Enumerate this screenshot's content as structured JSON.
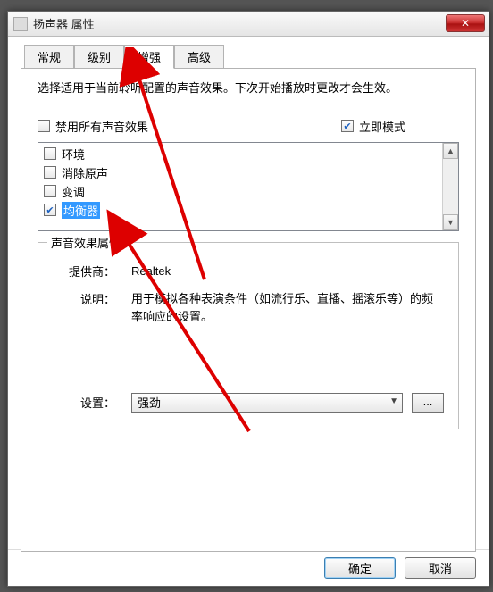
{
  "window": {
    "title": "扬声器 属性",
    "close_glyph": "✕"
  },
  "tabs": {
    "t0": "常规",
    "t1": "级别",
    "t2": "增强",
    "t3": "高级",
    "active_index": 2
  },
  "enhance": {
    "description": "选择适用于当前聆听配置的声音效果。下次开始播放时更改才会生效。",
    "disable_all_label": "禁用所有声音效果",
    "disable_all_checked": false,
    "immediate_label": "立即模式",
    "immediate_checked": true,
    "effects": [
      {
        "label": "环境",
        "checked": false,
        "selected": false
      },
      {
        "label": "消除原声",
        "checked": false,
        "selected": false
      },
      {
        "label": "变调",
        "checked": false,
        "selected": false
      },
      {
        "label": "均衡器",
        "checked": true,
        "selected": true
      }
    ],
    "scroll_up": "▲",
    "scroll_down": "▼"
  },
  "group": {
    "title": "声音效果属性",
    "provider_label": "提供商：",
    "provider_value": "Realtek",
    "desc_label": "说明：",
    "desc_value": "用于模拟各种表演条件（如流行乐、直播、摇滚乐等）的频率响应的设置。",
    "setting_label": "设置：",
    "setting_value": "强劲",
    "more_label": "...",
    "dd_arrow": "▼"
  },
  "footer": {
    "ok": "确定",
    "cancel": "取消"
  }
}
